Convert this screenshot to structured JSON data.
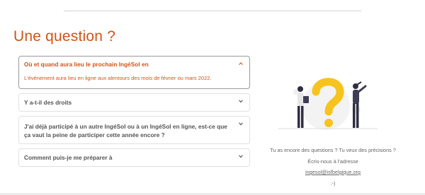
{
  "title": "Une question ?",
  "faq": [
    {
      "question": "Où et quand aura lieu le prochain IngéSol en",
      "answer": "L'événement aura lieu en ligne aux alentours des mois de févner ou mars 2022.",
      "open": true
    },
    {
      "question": "Y a-t-il des droits",
      "open": false
    },
    {
      "question": "J'ai déjà participé à un autre IngéSol ou à un IngéSol en ligne, est-ce que ça vaut la peine de participer cette année encore ?",
      "open": false
    },
    {
      "question": "Comment puis-je me préparer à",
      "open": false
    }
  ],
  "contact": {
    "line1": "Tu as encore des questions ? Tu veux des précisions ?",
    "line2": "Écris-nous à l'adresse",
    "email": "ingesol@isfbelgique.org",
    "smiley": ":-)"
  },
  "colors": {
    "accent": "#d35317",
    "illustration_yellow": "#f7c31e",
    "dark": "#2f2e41"
  }
}
